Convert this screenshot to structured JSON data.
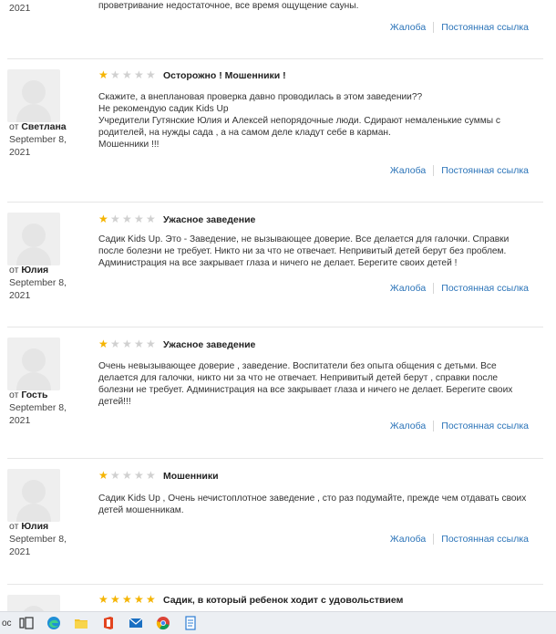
{
  "top": {
    "year": "2021",
    "text": "проветривание недостаточное, все время ощущение сауны.",
    "complaint": "Жалоба",
    "permalink": "Постоянная ссылка"
  },
  "reviews": [
    {
      "from": "от",
      "author": "Светлана",
      "date1": "September 8,",
      "date2": "2021",
      "rating": 1,
      "title": "Осторожно ! Мошенники !",
      "body": "Скажите, а внеплановая проверка давно проводилась в этом заведении??\nНе рекомендую садик Kids Up\nУчредители Гутянские Юлия и Алексей непорядочные люди. Сдирают немаленькие суммы с\nродителей, на нужды сада , а на самом деле кладут себе в карман.\nМошенники !!!",
      "complaint": "Жалоба",
      "permalink": "Постоянная ссылка"
    },
    {
      "from": "от",
      "author": "Юлия",
      "date1": "September 8,",
      "date2": "2021",
      "rating": 1,
      "title": "Ужасное заведение",
      "body": "Садик Kids Up. Это - Заведение, не вызывающее доверие. Все делается для галочки. Справки\nпосле болезни не требует. Никто ни за что не отвечает. Непривитый детей берут без проблем.\nАдминистрация на все закрывает глаза и ничего не делает. Берегите своих детей !",
      "complaint": "Жалоба",
      "permalink": "Постоянная ссылка"
    },
    {
      "from": "от",
      "author": "Гость",
      "date1": "September 8,",
      "date2": "2021",
      "rating": 1,
      "title": "Ужасное заведение",
      "body": "Очень невызывающее доверие , заведение. Воспитатели без опыта общения с детьми. Все\nделается для галочки, никто ни за что не отвечает. Непривитый детей берут , справки после\nболезни не требует. Администрация на все закрывает глаза и ничего не делает. Берегите своих\nдетей!!!",
      "complaint": "Жалоба",
      "permalink": "Постоянная ссылка"
    },
    {
      "from": "от",
      "author": "Юлия",
      "date1": "September 8,",
      "date2": "2021",
      "rating": 1,
      "title": "Мошенники",
      "body": "Садик Kids Up , Очень нечистоплотное заведение , сто раз подумайте, прежде чем отдавать своих\nдетей мошенникам.",
      "complaint": "Жалоба",
      "permalink": "Постоянная ссылка"
    },
    {
      "rating": 5,
      "title": "Садик, в который ребенок ходит с удовольствием"
    }
  ],
  "colors": {
    "link": "#2a73b8",
    "star_on": "#f5b400",
    "star_off": "#d0d0d0"
  },
  "taskbar": {
    "left_text": "ос",
    "icons": [
      "task-view-icon",
      "edge-icon",
      "file-explorer-icon",
      "office-icon",
      "mail-icon",
      "chrome-icon",
      "document-icon"
    ]
  }
}
